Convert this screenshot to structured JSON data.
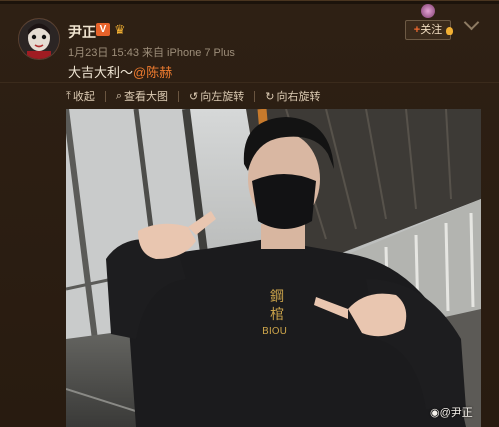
{
  "post": {
    "username": "尹正",
    "verified_badge": "V",
    "follow_label": "关注",
    "timestamp": "1月23日 15:43",
    "source": "来自 iPhone 7 Plus",
    "text": "大吉大利～",
    "mention": "@陈赫"
  },
  "toolbar": {
    "collapse": "收起",
    "view_large": "查看大图",
    "rotate_left": "向左旋转",
    "rotate_right": "向右旋转"
  },
  "photo": {
    "shirt_text_line1": "鋼",
    "shirt_text_line2": "棺",
    "shirt_text_line3": "BIOU",
    "watermark": "@尹正"
  },
  "colors": {
    "background": "#2a1d12",
    "accent_orange": "#ee7b2f",
    "verified_orange": "#e7622a"
  }
}
